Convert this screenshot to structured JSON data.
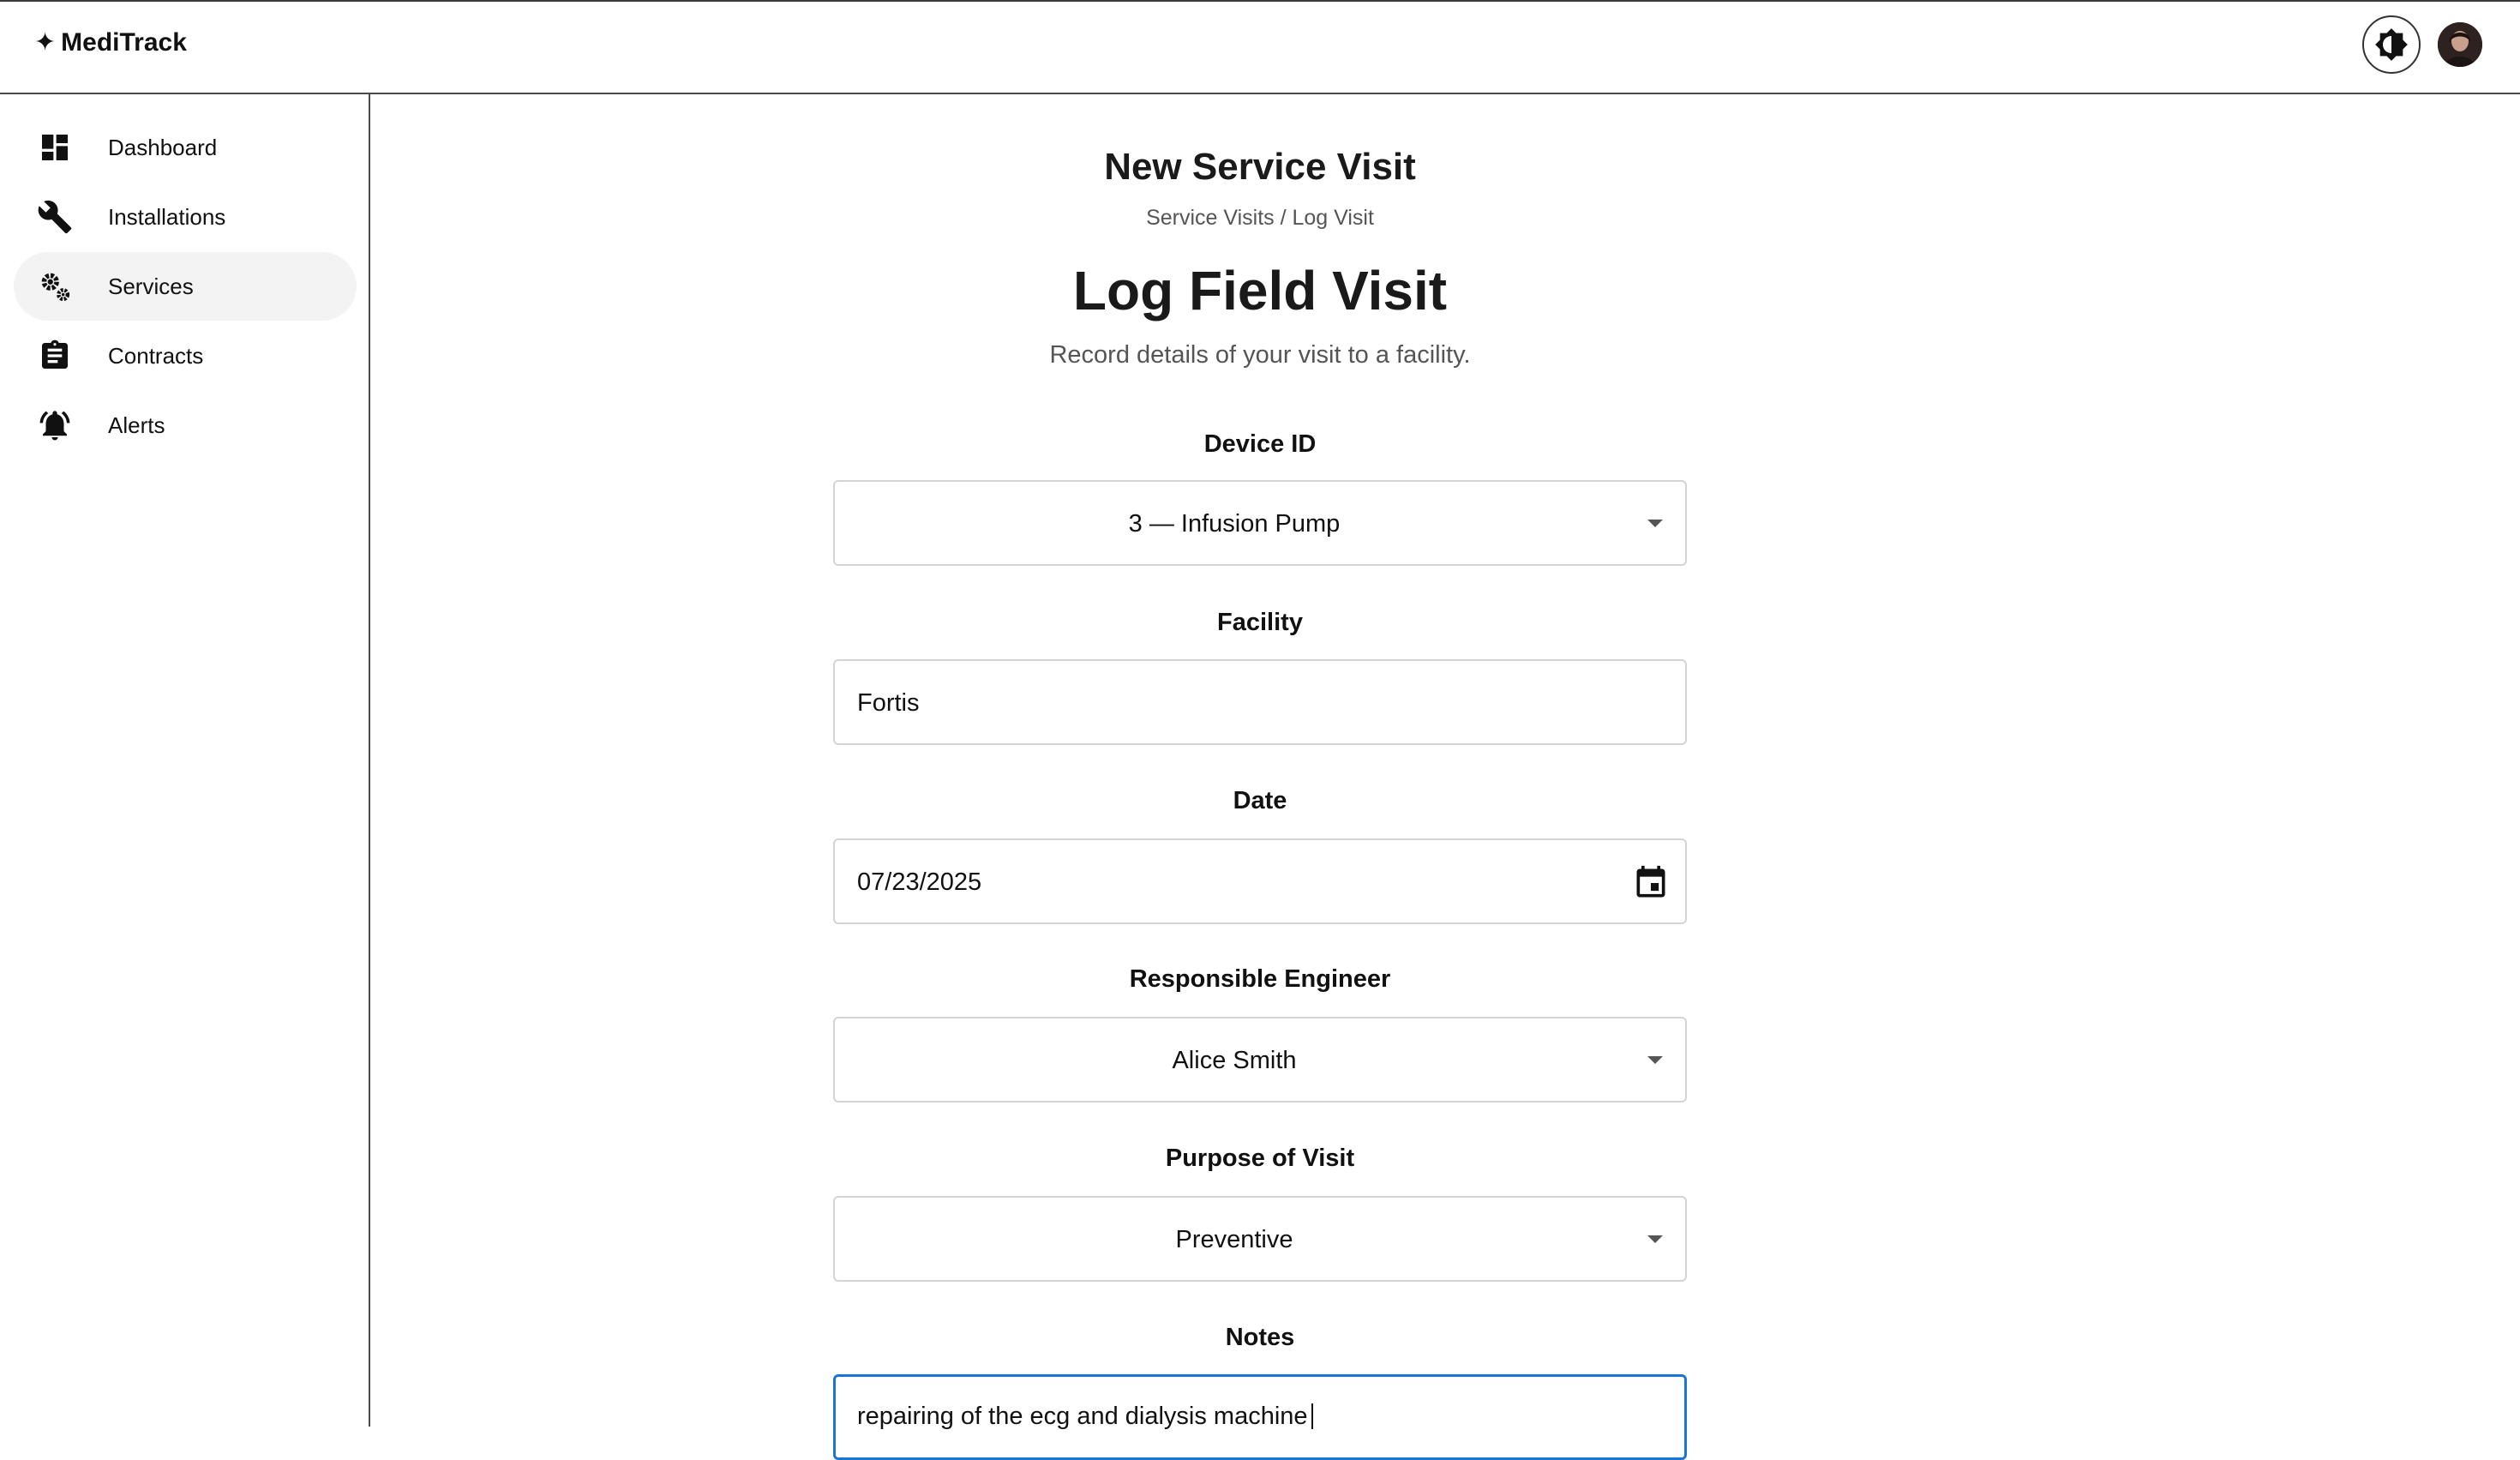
{
  "app": {
    "brand_glyph": "✦",
    "brand_name": "MediTrack"
  },
  "header": {
    "theme_icon": "brightness-icon",
    "avatar": "user-avatar"
  },
  "sidebar": {
    "items": [
      {
        "label": "Dashboard",
        "icon": "dashboard-icon",
        "active": false
      },
      {
        "label": "Installations",
        "icon": "wrench-icon",
        "active": false
      },
      {
        "label": "Services",
        "icon": "gears-icon",
        "active": true
      },
      {
        "label": "Contracts",
        "icon": "clipboard-icon",
        "active": false
      },
      {
        "label": "Alerts",
        "icon": "bell-icon",
        "active": false
      }
    ]
  },
  "page": {
    "title": "New Service Visit",
    "breadcrumb": "Service Visits / Log Visit",
    "heading": "Log Field Visit",
    "subtitle": "Record details of your visit to a facility."
  },
  "form": {
    "device": {
      "label": "Device ID",
      "value": "3 — Infusion Pump"
    },
    "facility": {
      "label": "Facility",
      "value": "Fortis"
    },
    "date": {
      "label": "Date",
      "value": "07/23/2025"
    },
    "engineer": {
      "label": "Responsible Engineer",
      "value": "Alice Smith"
    },
    "purpose": {
      "label": "Purpose of Visit",
      "value": "Preventive"
    },
    "notes": {
      "label": "Notes",
      "value": "repairing of the ecg and dialysis machine"
    }
  },
  "colors": {
    "focus": "#1976d2",
    "active_nav_bg": "#f3f3f3",
    "border": "#d4d4d4"
  }
}
